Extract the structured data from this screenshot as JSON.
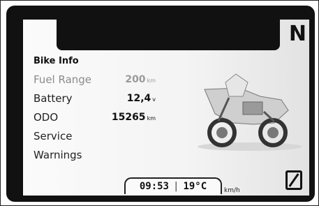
{
  "display": {
    "gear": "N",
    "menu_title": "Bike Info",
    "rows": [
      {
        "label": "Fuel Range",
        "value": "200",
        "unit": "km"
      },
      {
        "label": "Battery",
        "value": "12,4",
        "unit": "v"
      },
      {
        "label": "ODO",
        "value": "15265",
        "unit": "km"
      },
      {
        "label": "Service"
      },
      {
        "label": "Warnings"
      }
    ],
    "status": {
      "time": "09:53",
      "separator": "|",
      "temperature": "19°C"
    },
    "speed_unit": "km/h"
  },
  "icons": {
    "bike": "motorcycle-image",
    "zero": "zero-symbol-icon"
  },
  "colors": {
    "screen_bg": "#f3f3f3",
    "bezel": "#111111",
    "dim_text": "#8b8b8b"
  }
}
